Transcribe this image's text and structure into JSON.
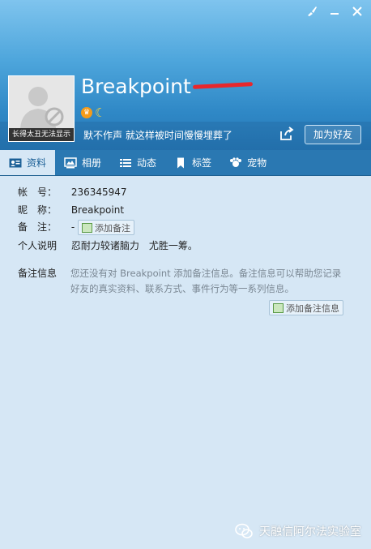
{
  "window": {
    "controls": {
      "skin_icon": "brush-icon",
      "minimize_icon": "minimize-icon",
      "close_icon": "close-icon"
    }
  },
  "profile": {
    "avatar_caption": "长得太丑无法显示",
    "nickname": "Breakpoint",
    "signature": "默不作声 就这样被时间慢慢埋葬了",
    "add_friend_label": "加为好友"
  },
  "tabs": [
    {
      "label": "资料",
      "icon": "profile-card-icon",
      "active": true
    },
    {
      "label": "相册",
      "icon": "photo-album-icon"
    },
    {
      "label": "动态",
      "icon": "feed-list-icon"
    },
    {
      "label": "标签",
      "icon": "bookmark-icon"
    },
    {
      "label": "宠物",
      "icon": "paw-icon"
    }
  ],
  "details": {
    "account_label": "帐　号：",
    "account_value": "236345947",
    "nickname_label": "昵　称：",
    "nickname_value": "Breakpoint",
    "remark_label": "备　注：",
    "remark_value": "-",
    "remark_button": "添加备注",
    "bio_label": "个人说明",
    "bio_value": "忍耐力较诸脑力　尤胜一筹。",
    "remark_info_label": "备注信息",
    "remark_info_text": "您还没有对 Breakpoint 添加备注信息。备注信息可以帮助您记录好友的真实资料、联系方式、事件行为等一系列信息。",
    "remark_info_button": "添加备注信息"
  },
  "watermark": "天融信阿尔法实验室",
  "colors": {
    "header_top": "#7fc4ee",
    "header_bottom": "#2678b6",
    "tab_bar": "#2a78b2",
    "panel": "#d6e7f5",
    "redaction": "#e8272c"
  }
}
